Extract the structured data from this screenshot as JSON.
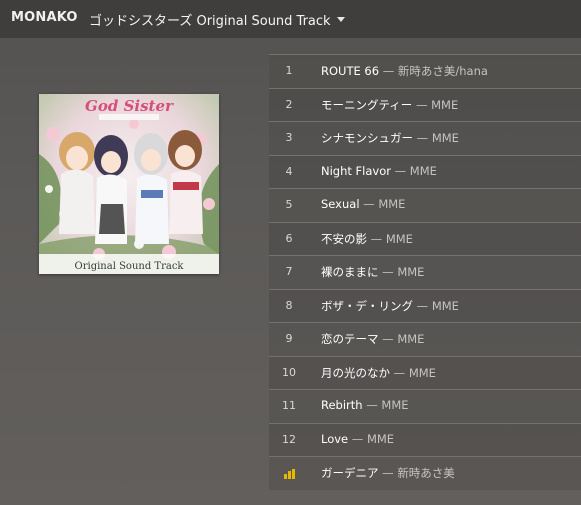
{
  "app": {
    "name": "MONAKO",
    "album_title": "ゴッドシスターズ Original Sound Track",
    "accent_color": "#e6b800"
  },
  "cover": {
    "logo_text": "God Sister",
    "caption": "Original Sound Track"
  },
  "tracks": [
    {
      "number": "1",
      "title": "ROUTE 66",
      "separator": " — ",
      "artist": "新時あさ美/hana",
      "playing": false
    },
    {
      "number": "2",
      "title": "モーニングティー",
      "separator": " — ",
      "artist": "MME",
      "playing": false
    },
    {
      "number": "3",
      "title": "シナモンシュガー",
      "separator": " — ",
      "artist": "MME",
      "playing": false
    },
    {
      "number": "4",
      "title": "Night Flavor",
      "separator": " — ",
      "artist": "MME",
      "playing": false
    },
    {
      "number": "5",
      "title": "Sexual",
      "separator": " — ",
      "artist": "MME",
      "playing": false
    },
    {
      "number": "6",
      "title": "不安の影",
      "separator": " — ",
      "artist": "MME",
      "playing": false
    },
    {
      "number": "7",
      "title": "裸のままに",
      "separator": " — ",
      "artist": "MME",
      "playing": false
    },
    {
      "number": "8",
      "title": "ボザ・デ・リング",
      "separator": " — ",
      "artist": "MME",
      "playing": false
    },
    {
      "number": "9",
      "title": "恋のテーマ",
      "separator": " — ",
      "artist": "MME",
      "playing": false
    },
    {
      "number": "10",
      "title": "月の光のなか",
      "separator": " — ",
      "artist": "MME",
      "playing": false
    },
    {
      "number": "11",
      "title": "Rebirth",
      "separator": " — ",
      "artist": "MME",
      "playing": false
    },
    {
      "number": "12",
      "title": "Love",
      "separator": " — ",
      "artist": "MME",
      "playing": false
    },
    {
      "number": "",
      "title": "ガーデニア",
      "separator": " — ",
      "artist": "新時あさ美",
      "playing": true,
      "icon": "now-playing-bars-icon"
    }
  ]
}
